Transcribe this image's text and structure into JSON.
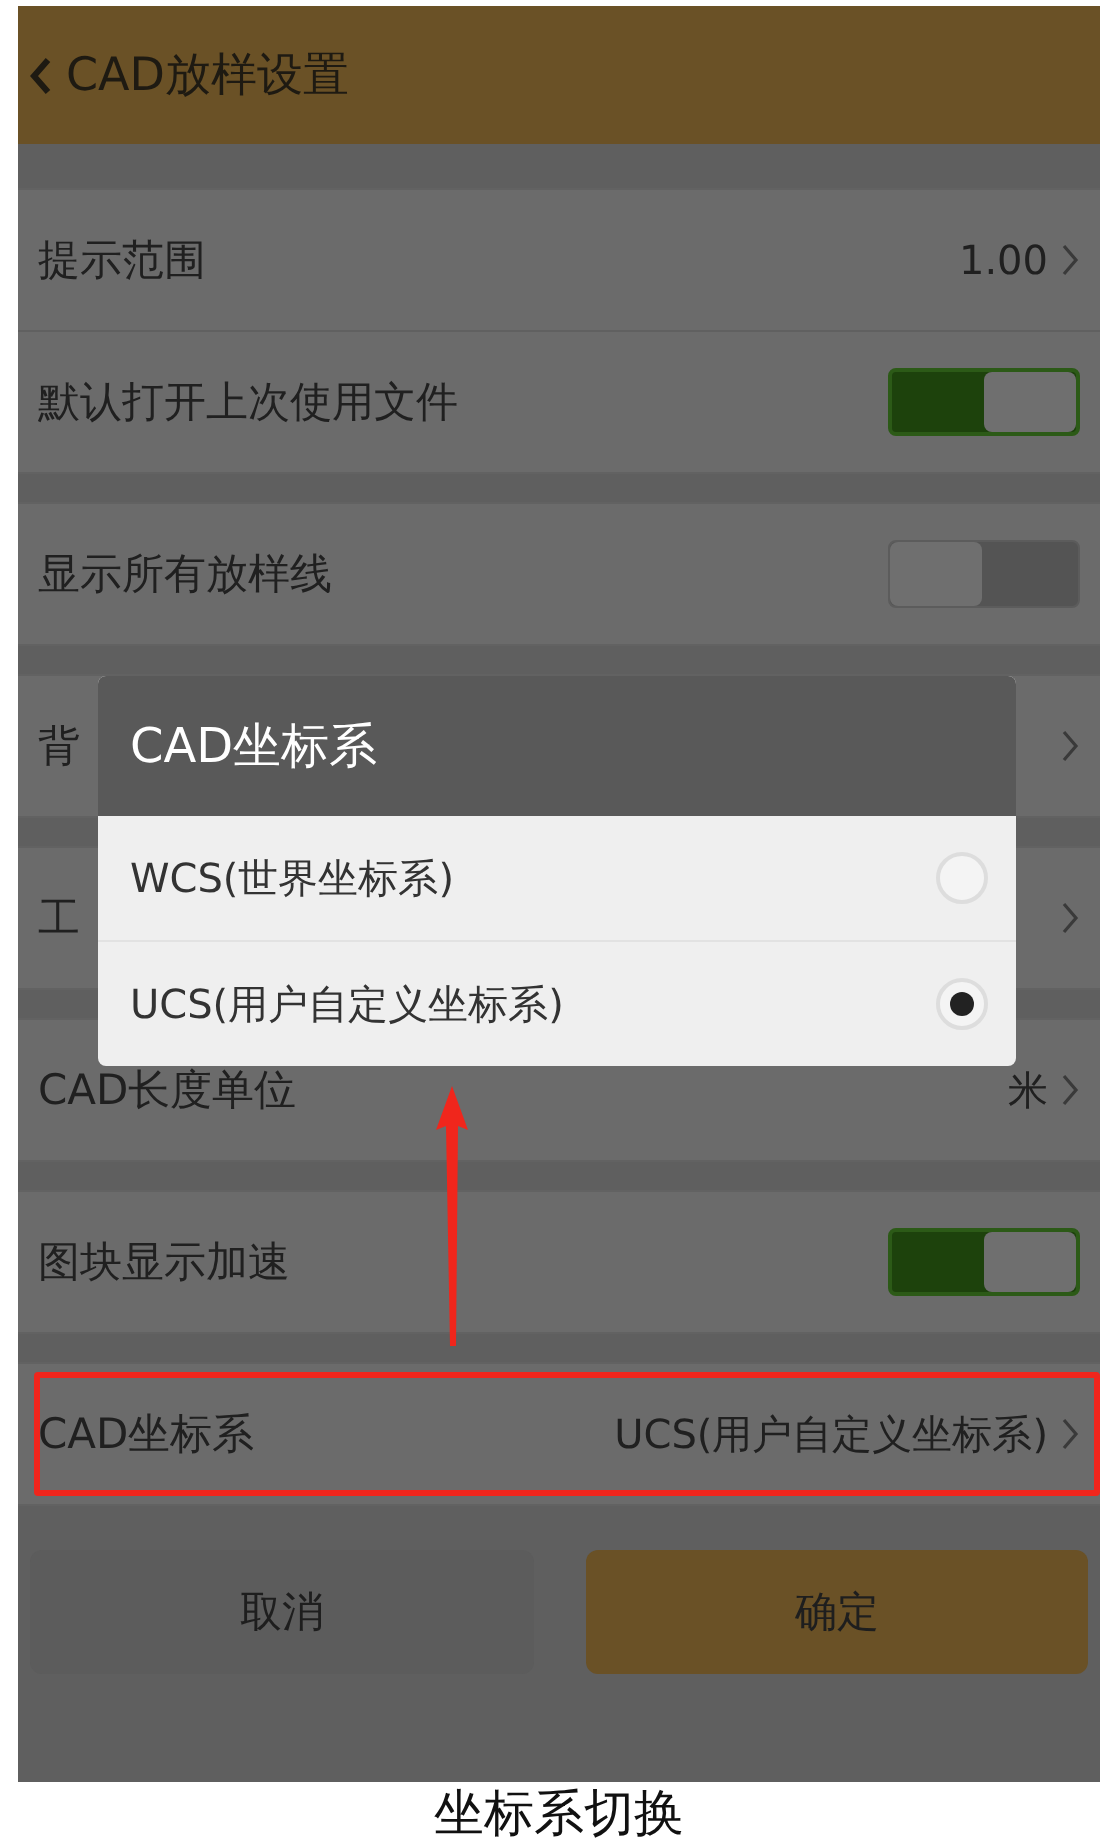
{
  "header": {
    "title": "CAD放样设置"
  },
  "groups": [
    [
      {
        "kind": "value",
        "label": "提示范围",
        "value": "1.00",
        "highlighted": false
      },
      {
        "kind": "toggle",
        "label": "默认打开上次使用文件",
        "on": true,
        "highlighted": false
      }
    ],
    [
      {
        "kind": "toggle",
        "label": "显示所有放样线",
        "on": false,
        "highlighted": false
      }
    ],
    [
      {
        "kind": "value",
        "label": "背",
        "highlighted": false
      }
    ],
    [
      {
        "kind": "value",
        "label": "工",
        "highlighted": false
      }
    ],
    [
      {
        "kind": "value",
        "label": "CAD长度单位",
        "value": "米",
        "highlighted": false
      }
    ],
    [
      {
        "kind": "toggle",
        "label": "图块显示加速",
        "on": true,
        "highlighted": false
      }
    ],
    [
      {
        "kind": "value",
        "label": "CAD坐标系",
        "value": "UCS(用户自定义坐标系)",
        "highlighted": true
      }
    ]
  ],
  "buttons": [
    {
      "label": "取消",
      "kind": "cancel"
    },
    {
      "label": "确定",
      "kind": "confirm"
    }
  ],
  "dialog": {
    "title": "CAD坐标系",
    "options": [
      {
        "label": "WCS(世界坐标系)",
        "selected": false
      },
      {
        "label": "UCS(用户自定义坐标系)",
        "selected": true
      }
    ]
  },
  "caption": "坐标系切换"
}
